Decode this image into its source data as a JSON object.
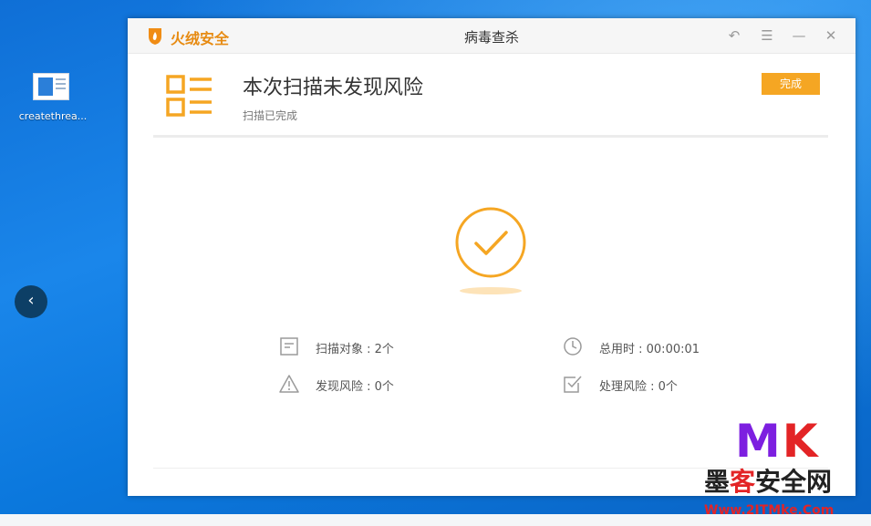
{
  "desktop": {
    "icon_label": "createthrea...",
    "back_glyph": "‹"
  },
  "window": {
    "brand": "火绒安全",
    "title": "病毒查杀",
    "controls": {
      "back_glyph": "↶",
      "menu_glyph": "☰",
      "minimize_glyph": "—",
      "close_glyph": "✕"
    }
  },
  "result": {
    "title": "本次扫描未发现风险",
    "subtitle": "扫描已完成",
    "done_button": "完成"
  },
  "stats": {
    "scan_objects": "扫描对象 : 2个",
    "total_time": "总用时 : 00:00:01",
    "risks_found": "发现风险 : 0个",
    "risks_handled": "处理风险 : 0个"
  },
  "watermark": {
    "mk_m": "M",
    "mk_k": "K",
    "cn_a": "墨",
    "cn_b": "客",
    "cn_c": "安全网",
    "url": "Www.2ITMke.Com"
  },
  "colors": {
    "accent": "#f5a623",
    "brand": "#e78b12",
    "desktop": "#1a86ea"
  }
}
